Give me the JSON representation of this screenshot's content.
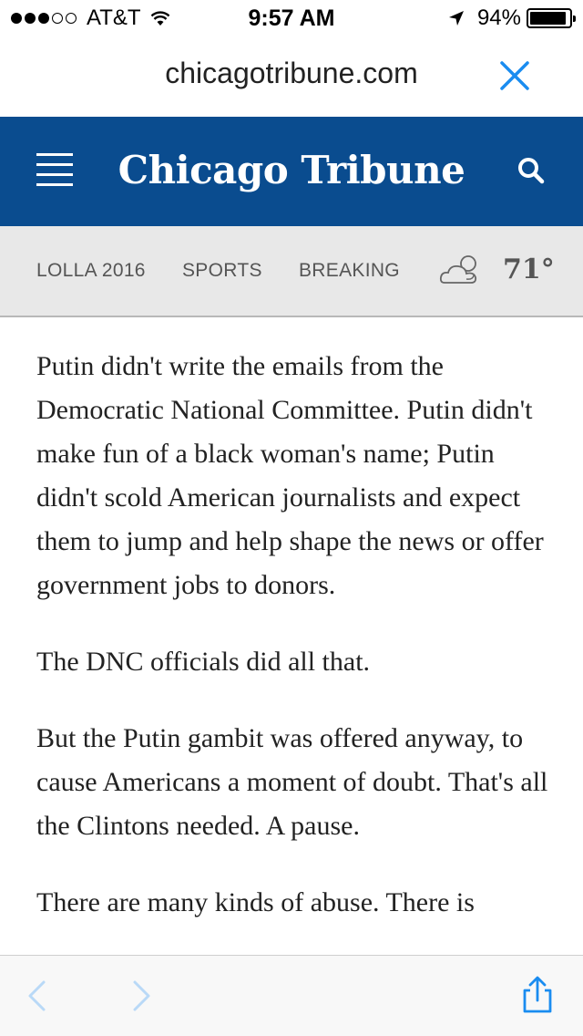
{
  "status_bar": {
    "carrier": "AT&T",
    "time": "9:57 AM",
    "battery_percent": "94%",
    "battery_level": 0.94,
    "signal_bars_filled": 3,
    "signal_bars_total": 5
  },
  "url_bar": {
    "domain": "chicagotribune.com",
    "close_icon": "close-icon"
  },
  "header": {
    "logo_text": "Chicago Tribune",
    "background_color": "#0a4c8f",
    "menu_icon": "menu-icon",
    "search_icon": "search-icon"
  },
  "nav": {
    "items": [
      {
        "label": "LOLLA 2016"
      },
      {
        "label": "SPORTS"
      },
      {
        "label": "BREAKING"
      }
    ],
    "weather": {
      "icon": "partly-cloudy-icon",
      "temperature": "71°"
    }
  },
  "article": {
    "paragraphs": [
      "Putin didn't write the emails from the Democratic National Committee. Putin didn't make fun of a black woman's name; Putin didn't scold American journalists and expect them to jump and help shape the news or offer government jobs to donors.",
      "The DNC officials did all that.",
      "But the Putin gambit was offered anyway, to cause Americans a moment of doubt. That's all the Clintons needed. A pause.",
      "There are many kinds of abuse. There is"
    ]
  },
  "toolbar": {
    "accent_color": "#1a8cf0",
    "back_icon": "chevron-left-icon",
    "forward_icon": "chevron-right-icon",
    "share_icon": "share-icon"
  }
}
